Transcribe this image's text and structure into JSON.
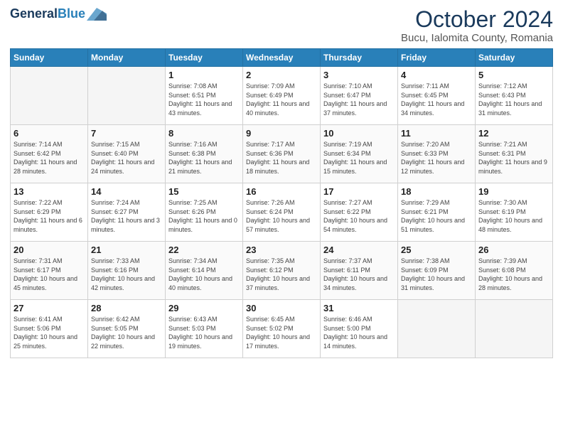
{
  "header": {
    "logo_line1": "General",
    "logo_line2": "Blue",
    "month": "October 2024",
    "location": "Bucu, Ialomita County, Romania"
  },
  "weekdays": [
    "Sunday",
    "Monday",
    "Tuesday",
    "Wednesday",
    "Thursday",
    "Friday",
    "Saturday"
  ],
  "weeks": [
    [
      {
        "day": "",
        "info": ""
      },
      {
        "day": "",
        "info": ""
      },
      {
        "day": "1",
        "info": "Sunrise: 7:08 AM\nSunset: 6:51 PM\nDaylight: 11 hours and 43 minutes."
      },
      {
        "day": "2",
        "info": "Sunrise: 7:09 AM\nSunset: 6:49 PM\nDaylight: 11 hours and 40 minutes."
      },
      {
        "day": "3",
        "info": "Sunrise: 7:10 AM\nSunset: 6:47 PM\nDaylight: 11 hours and 37 minutes."
      },
      {
        "day": "4",
        "info": "Sunrise: 7:11 AM\nSunset: 6:45 PM\nDaylight: 11 hours and 34 minutes."
      },
      {
        "day": "5",
        "info": "Sunrise: 7:12 AM\nSunset: 6:43 PM\nDaylight: 11 hours and 31 minutes."
      }
    ],
    [
      {
        "day": "6",
        "info": "Sunrise: 7:14 AM\nSunset: 6:42 PM\nDaylight: 11 hours and 28 minutes."
      },
      {
        "day": "7",
        "info": "Sunrise: 7:15 AM\nSunset: 6:40 PM\nDaylight: 11 hours and 24 minutes."
      },
      {
        "day": "8",
        "info": "Sunrise: 7:16 AM\nSunset: 6:38 PM\nDaylight: 11 hours and 21 minutes."
      },
      {
        "day": "9",
        "info": "Sunrise: 7:17 AM\nSunset: 6:36 PM\nDaylight: 11 hours and 18 minutes."
      },
      {
        "day": "10",
        "info": "Sunrise: 7:19 AM\nSunset: 6:34 PM\nDaylight: 11 hours and 15 minutes."
      },
      {
        "day": "11",
        "info": "Sunrise: 7:20 AM\nSunset: 6:33 PM\nDaylight: 11 hours and 12 minutes."
      },
      {
        "day": "12",
        "info": "Sunrise: 7:21 AM\nSunset: 6:31 PM\nDaylight: 11 hours and 9 minutes."
      }
    ],
    [
      {
        "day": "13",
        "info": "Sunrise: 7:22 AM\nSunset: 6:29 PM\nDaylight: 11 hours and 6 minutes."
      },
      {
        "day": "14",
        "info": "Sunrise: 7:24 AM\nSunset: 6:27 PM\nDaylight: 11 hours and 3 minutes."
      },
      {
        "day": "15",
        "info": "Sunrise: 7:25 AM\nSunset: 6:26 PM\nDaylight: 11 hours and 0 minutes."
      },
      {
        "day": "16",
        "info": "Sunrise: 7:26 AM\nSunset: 6:24 PM\nDaylight: 10 hours and 57 minutes."
      },
      {
        "day": "17",
        "info": "Sunrise: 7:27 AM\nSunset: 6:22 PM\nDaylight: 10 hours and 54 minutes."
      },
      {
        "day": "18",
        "info": "Sunrise: 7:29 AM\nSunset: 6:21 PM\nDaylight: 10 hours and 51 minutes."
      },
      {
        "day": "19",
        "info": "Sunrise: 7:30 AM\nSunset: 6:19 PM\nDaylight: 10 hours and 48 minutes."
      }
    ],
    [
      {
        "day": "20",
        "info": "Sunrise: 7:31 AM\nSunset: 6:17 PM\nDaylight: 10 hours and 45 minutes."
      },
      {
        "day": "21",
        "info": "Sunrise: 7:33 AM\nSunset: 6:16 PM\nDaylight: 10 hours and 42 minutes."
      },
      {
        "day": "22",
        "info": "Sunrise: 7:34 AM\nSunset: 6:14 PM\nDaylight: 10 hours and 40 minutes."
      },
      {
        "day": "23",
        "info": "Sunrise: 7:35 AM\nSunset: 6:12 PM\nDaylight: 10 hours and 37 minutes."
      },
      {
        "day": "24",
        "info": "Sunrise: 7:37 AM\nSunset: 6:11 PM\nDaylight: 10 hours and 34 minutes."
      },
      {
        "day": "25",
        "info": "Sunrise: 7:38 AM\nSunset: 6:09 PM\nDaylight: 10 hours and 31 minutes."
      },
      {
        "day": "26",
        "info": "Sunrise: 7:39 AM\nSunset: 6:08 PM\nDaylight: 10 hours and 28 minutes."
      }
    ],
    [
      {
        "day": "27",
        "info": "Sunrise: 6:41 AM\nSunset: 5:06 PM\nDaylight: 10 hours and 25 minutes."
      },
      {
        "day": "28",
        "info": "Sunrise: 6:42 AM\nSunset: 5:05 PM\nDaylight: 10 hours and 22 minutes."
      },
      {
        "day": "29",
        "info": "Sunrise: 6:43 AM\nSunset: 5:03 PM\nDaylight: 10 hours and 19 minutes."
      },
      {
        "day": "30",
        "info": "Sunrise: 6:45 AM\nSunset: 5:02 PM\nDaylight: 10 hours and 17 minutes."
      },
      {
        "day": "31",
        "info": "Sunrise: 6:46 AM\nSunset: 5:00 PM\nDaylight: 10 hours and 14 minutes."
      },
      {
        "day": "",
        "info": ""
      },
      {
        "day": "",
        "info": ""
      }
    ]
  ]
}
